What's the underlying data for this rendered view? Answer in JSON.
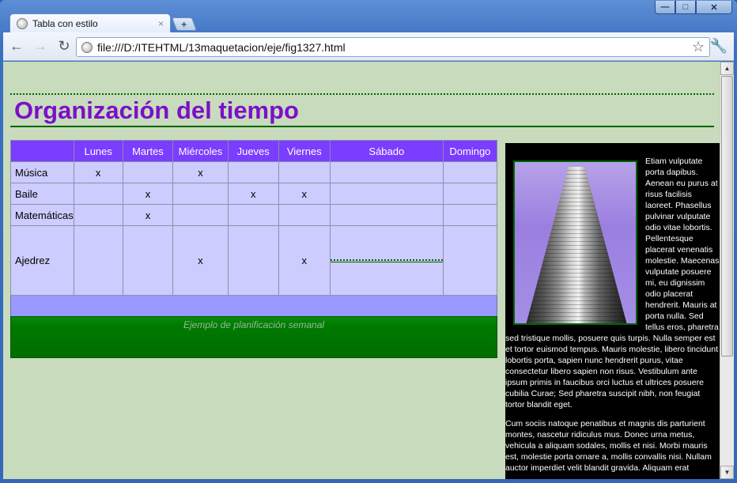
{
  "window": {
    "tab_title": "Tabla con estilo",
    "tab_close": "×",
    "new_tab": "+",
    "controls": {
      "minimize": "—",
      "maximize": "□",
      "close": "✕"
    }
  },
  "toolbar": {
    "back": "←",
    "forward": "→",
    "reload": "↻",
    "url": "file:///D:/ITEHTML/13maquetacion/eje/fig1327.html",
    "star": "☆",
    "wrench": "🔧"
  },
  "page": {
    "title": "Organización del tiempo",
    "table": {
      "headers": [
        "",
        "Lunes",
        "Martes",
        "Miércoles",
        "Jueves",
        "Viernes",
        "Sábado",
        "Domingo"
      ],
      "rows": [
        {
          "label": "Música",
          "cells": [
            "x",
            "",
            "x",
            "",
            "",
            "",
            ""
          ]
        },
        {
          "label": "Baile",
          "cells": [
            "",
            "x",
            "",
            "x",
            "x",
            "",
            ""
          ]
        },
        {
          "label": "Matemáticas",
          "cells": [
            "",
            "x",
            "",
            "",
            "",
            "",
            ""
          ]
        },
        {
          "label": "Ajedrez",
          "cells": [
            "",
            "",
            "x",
            "",
            "x",
            "",
            ""
          ]
        }
      ],
      "caption": "Ejemplo de planificación semanal"
    },
    "aside": {
      "p1": "Etiam vulputate porta dapibus. Aenean eu purus at risus facilisis laoreet. Phasellus pulvinar vulputate odio vitae lobortis. Pellentesque placerat venenatis molestie. Maecenas vulputate posuere mi, eu dignissim odio placerat hendrerit. Mauris at porta nulla. Sed tellus eros, pharetra sed tristique mollis, posuere quis turpis. Nulla semper est et tortor euismod tempus. Mauris molestie, libero tincidunt lobortis porta, sapien nunc hendrerit purus, vitae consectetur libero sapien non risus. Vestibulum ante ipsum primis in faucibus orci luctus et ultrices posuere cubilia Curae; Sed pharetra suscipit nibh, non feugiat tortor blandit eget.",
      "p2": "Cum sociis natoque penatibus et magnis dis parturient montes, nascetur ridiculus mus. Donec urna metus, vehicula a aliquam sodales, mollis et nisi. Morbi mauris est, molestie porta ornare a, mollis convallis nisi. Nullam auctor imperdiet velit blandit gravida. Aliquam erat"
    }
  },
  "colors": {
    "page_bg": "#c8dbbd",
    "title": "#7b10c8",
    "table_header": "#7b3dff",
    "table_body": "#ccccff",
    "table_footer": "#9999ff",
    "caption_bg": "#007a00",
    "aside_bg": "#000000"
  }
}
